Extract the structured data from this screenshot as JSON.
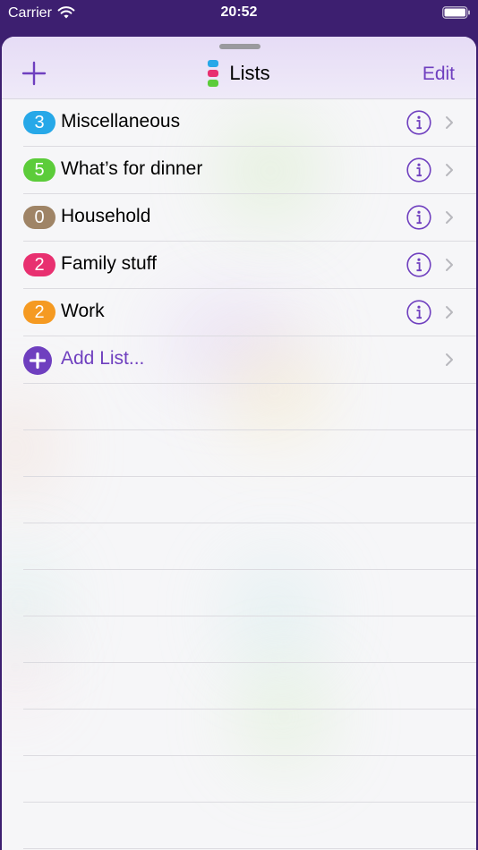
{
  "status_bar": {
    "carrier": "Carrier",
    "time": "20:52"
  },
  "nav": {
    "title": "Lists",
    "edit_label": "Edit"
  },
  "colors": {
    "accent": "#6f3fbf",
    "blue": "#27a8e8",
    "green": "#5ccc3a",
    "brown": "#9f8466",
    "pink": "#e83070",
    "orange": "#f59a22"
  },
  "lists": [
    {
      "count": "3",
      "name": "Miscellaneous",
      "color": "#27a8e8"
    },
    {
      "count": "5",
      "name": "What’s for dinner",
      "color": "#5ccc3a"
    },
    {
      "count": "0",
      "name": "Household",
      "color": "#9f8466"
    },
    {
      "count": "2",
      "name": "Family stuff",
      "color": "#e83070"
    },
    {
      "count": "2",
      "name": "Work",
      "color": "#f59a22"
    }
  ],
  "add_list_label": "Add List..."
}
